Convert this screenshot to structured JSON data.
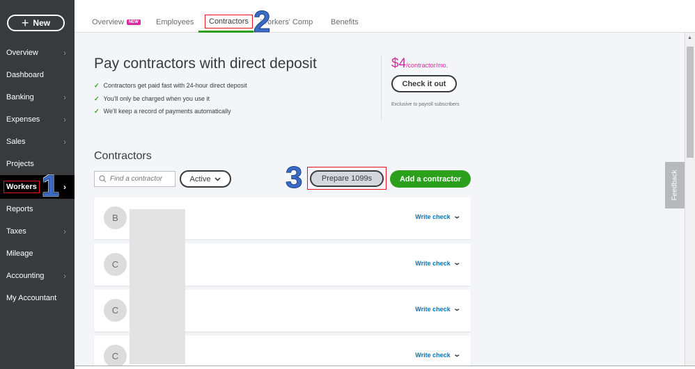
{
  "sidebar": {
    "new_label": "New",
    "items": [
      {
        "label": "Overview",
        "chevron": true
      },
      {
        "label": "Dashboard",
        "chevron": false
      },
      {
        "label": "Banking",
        "chevron": true
      },
      {
        "label": "Expenses",
        "chevron": true
      },
      {
        "label": "Sales",
        "chevron": true
      },
      {
        "label": "Projects",
        "chevron": false
      },
      {
        "label": "Workers",
        "chevron": true,
        "active": true
      },
      {
        "label": "Reports",
        "chevron": false
      },
      {
        "label": "Taxes",
        "chevron": true
      },
      {
        "label": "Mileage",
        "chevron": false
      },
      {
        "label": "Accounting",
        "chevron": true
      },
      {
        "label": "My Accountant",
        "chevron": false
      }
    ]
  },
  "tabs": [
    {
      "label": "Overview",
      "badge": "NEW"
    },
    {
      "label": "Employees"
    },
    {
      "label": "Contractors",
      "active": true
    },
    {
      "label": "Workers' Comp"
    },
    {
      "label": "Benefits"
    }
  ],
  "markers": [
    "1",
    "2",
    "3"
  ],
  "promo": {
    "title": "Pay contractors with direct deposit",
    "bullets": [
      "Contractors get paid fast with 24-hour direct deposit",
      "You'll only be charged when you use it",
      "We'll keep a record of payments automatically"
    ],
    "price": "$4",
    "price_unit": "/contractor/mo.",
    "cta": "Check it out",
    "note": "Exclusive to payroll subscribers"
  },
  "contractors": {
    "title": "Contractors",
    "search_placeholder": "Find a contractor",
    "filter_value": "Active",
    "prepare_label": "Prepare 1099s",
    "add_label": "Add a contractor",
    "rows": [
      {
        "initial": "B",
        "action": "Write check"
      },
      {
        "initial": "C",
        "action": "Write check"
      },
      {
        "initial": "C",
        "action": "Write check"
      },
      {
        "initial": "C",
        "action": "Write check"
      }
    ]
  },
  "feedback_label": "Feedback",
  "colors": {
    "sidebar": "#393a3d",
    "accent_green": "#2ca01c",
    "accent_pink": "#d52b9f",
    "link_blue": "#0077c5",
    "annotation_red": "#e8101a",
    "marker_blue": "#3a6cc6"
  }
}
